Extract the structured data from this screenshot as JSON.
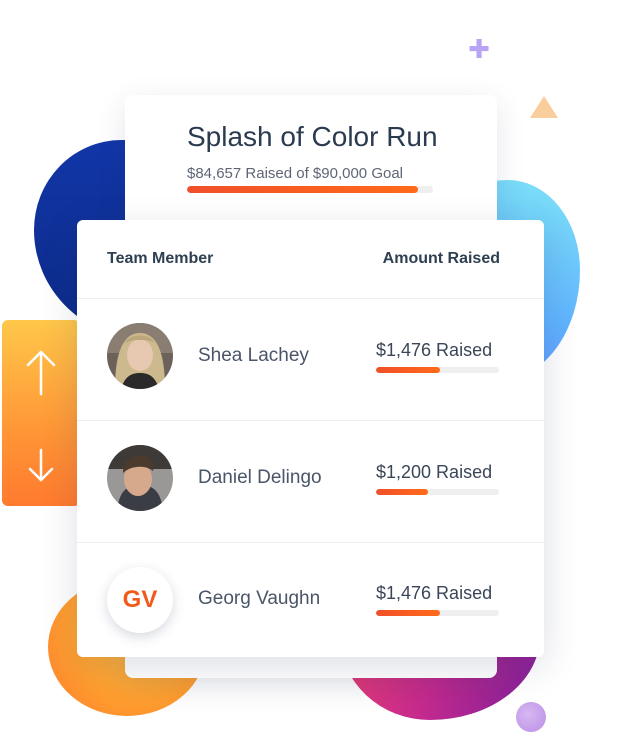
{
  "campaign": {
    "title": "Splash of Color Run",
    "raised_text": "$84,657 Raised of $90,000 Goal",
    "progress": 0.94
  },
  "table": {
    "header_member": "Team Member",
    "header_amount": "Amount Raised",
    "rows": [
      {
        "name": "Shea Lachey",
        "amount": "$1,476 Raised",
        "progress": 0.52,
        "avatar": "photo-woman"
      },
      {
        "name": "Daniel Delingo",
        "amount": "$1,200 Raised",
        "progress": 0.42,
        "avatar": "photo-man"
      },
      {
        "name": "Georg Vaughn",
        "amount": "$1,476 Raised",
        "progress": 0.52,
        "initials": "GV"
      }
    ]
  },
  "sort": {
    "up_icon": "arrow-up-icon",
    "down_icon": "arrow-down-icon"
  },
  "colors": {
    "accent": "#f25a1b",
    "progress_start": "#f0502a",
    "progress_end": "#ff6a1a",
    "title": "#2b3a4f"
  }
}
